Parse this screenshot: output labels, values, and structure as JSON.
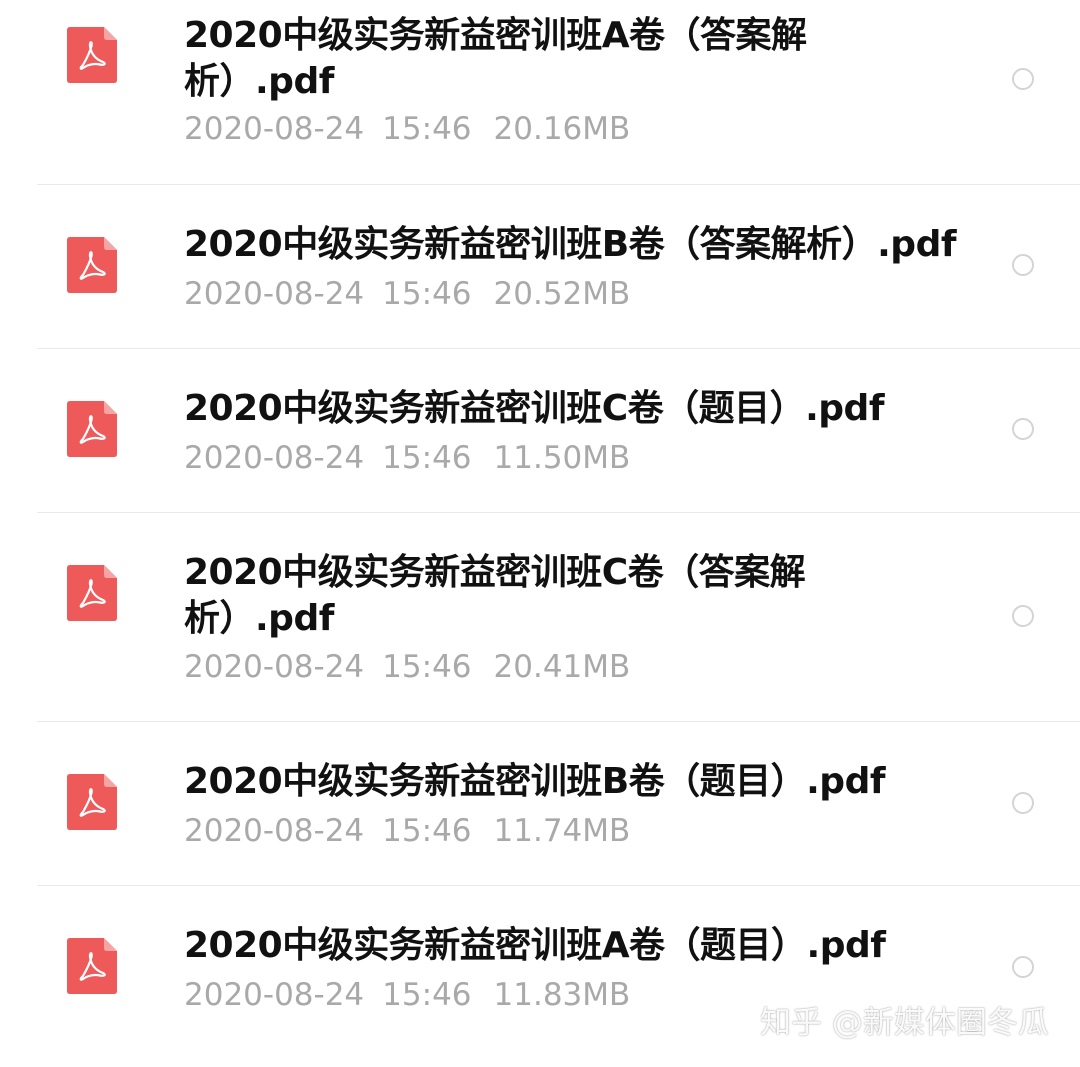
{
  "files": [
    {
      "name": "2020中级实务新益密训班A卷（答案解析）.pdf",
      "date": "2020-08-24",
      "time": "15:46",
      "size": "20.16MB",
      "icon": "pdf-icon",
      "selected": false
    },
    {
      "name": "2020中级实务新益密训班B卷（答案解析）.pdf",
      "date": "2020-08-24",
      "time": "15:46",
      "size": "20.52MB",
      "icon": "pdf-icon",
      "selected": false
    },
    {
      "name": "2020中级实务新益密训班C卷（题目）.pdf",
      "date": "2020-08-24",
      "time": "15:46",
      "size": "11.50MB",
      "icon": "pdf-icon",
      "selected": false
    },
    {
      "name": "2020中级实务新益密训班C卷（答案解析）.pdf",
      "date": "2020-08-24",
      "time": "15:46",
      "size": "20.41MB",
      "icon": "pdf-icon",
      "selected": false
    },
    {
      "name": "2020中级实务新益密训班B卷（题目）.pdf",
      "date": "2020-08-24",
      "time": "15:46",
      "size": "11.74MB",
      "icon": "pdf-icon",
      "selected": false
    },
    {
      "name": "2020中级实务新益密训班A卷（题目）.pdf",
      "date": "2020-08-24",
      "time": "15:46",
      "size": "11.83MB",
      "icon": "pdf-icon",
      "selected": false
    }
  ],
  "watermark": "知乎 @新媒体圈冬瓜",
  "colors": {
    "pdf_icon": "#ee5a5a",
    "name_text": "#111111",
    "meta_text": "#a9a9a9",
    "divider": "#e9e9e9",
    "radio_border": "#d4d4d4"
  }
}
